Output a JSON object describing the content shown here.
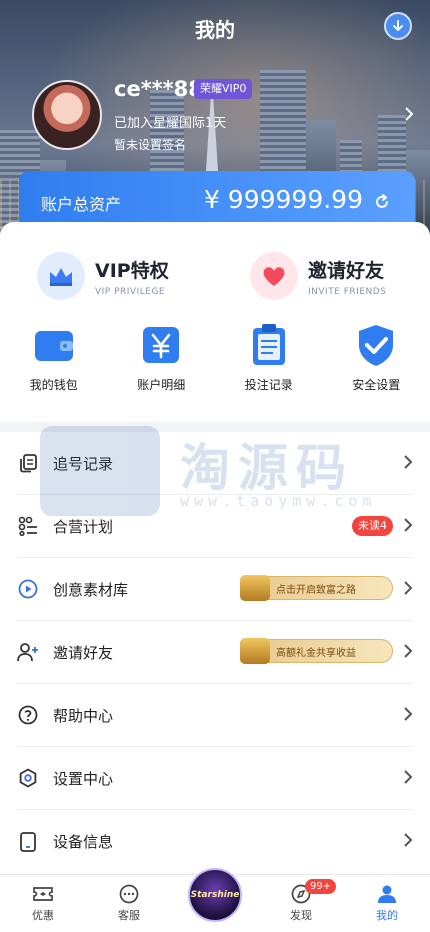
{
  "header": {
    "title": "我的",
    "username": "ce***88",
    "vip_badge": "荣耀VIP0",
    "joined_text": "已加入星耀国际1天",
    "signature": "暂未设置签名"
  },
  "assets": {
    "label": "账户总资产",
    "value": "¥ 999999.99"
  },
  "promos": [
    {
      "title": "VIP特权",
      "subtitle": "VIP PRIVILEGE",
      "icon": "crown-icon"
    },
    {
      "title": "邀请好友",
      "subtitle": "INVITE FRIENDS",
      "icon": "heart-icon"
    }
  ],
  "quick_actions": [
    {
      "label": "我的钱包",
      "icon": "wallet-icon"
    },
    {
      "label": "账户明细",
      "icon": "yuan-icon"
    },
    {
      "label": "投注记录",
      "icon": "clipboard-icon"
    },
    {
      "label": "安全设置",
      "icon": "shield-check-icon"
    }
  ],
  "menu": [
    {
      "label": "追号记录",
      "icon": "copy-icon"
    },
    {
      "label": "合营计划",
      "icon": "grid-icon",
      "badge": "未读4"
    },
    {
      "label": "创意素材库",
      "icon": "play-icon",
      "banner": "点击开启致富之路"
    },
    {
      "label": "邀请好友",
      "icon": "user-add-icon",
      "banner": "高额礼金共享收益"
    },
    {
      "label": "帮助中心",
      "icon": "help-icon"
    },
    {
      "label": "设置中心",
      "icon": "settings-icon"
    },
    {
      "label": "设备信息",
      "icon": "tablet-icon"
    }
  ],
  "watermark": {
    "title": "淘源码",
    "url": "www.taoymw.com"
  },
  "bottom_nav": [
    {
      "label": "优惠",
      "icon": "ticket-icon"
    },
    {
      "label": "客服",
      "icon": "chat-icon"
    },
    {
      "label": "",
      "icon": "starshine-logo"
    },
    {
      "label": "发现",
      "icon": "compass-icon",
      "badge": "99+"
    },
    {
      "label": "我的",
      "icon": "person-icon",
      "active": true
    }
  ],
  "center_logo_text": "Starshine",
  "colors": {
    "primary": "#2f7df0",
    "badge_red": "#f1453d",
    "vip_purple": "#6f56d9"
  }
}
